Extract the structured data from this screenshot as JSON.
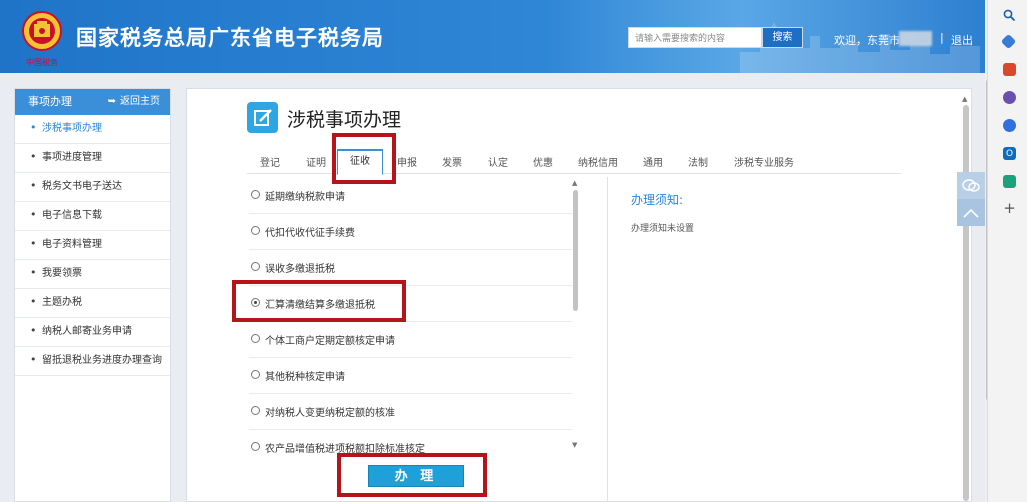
{
  "header": {
    "site_title": "国家税务总局广东省电子税务局",
    "emblem_caption": "中国税务",
    "search": {
      "placeholder": "请输入需要搜索的内容",
      "button_label": "搜索"
    },
    "welcome_text": "欢迎，东莞市",
    "separator": "|",
    "logout_label": "退出"
  },
  "sidebar": {
    "title": "事项办理",
    "back_home_label": "返回主页",
    "items": [
      {
        "label": "涉税事项办理",
        "active": true
      },
      {
        "label": "事项进度管理"
      },
      {
        "label": "税务文书电子送达"
      },
      {
        "label": "电子信息下载"
      },
      {
        "label": "电子资料管理"
      },
      {
        "label": "我要领票"
      },
      {
        "label": "主题办税"
      },
      {
        "label": "纳税人邮寄业务申请"
      },
      {
        "label": "留抵退税业务进度办理查询"
      }
    ]
  },
  "main": {
    "page_title": "涉税事项办理",
    "tabs": [
      {
        "label": "登记"
      },
      {
        "label": "证明"
      },
      {
        "label": "征收",
        "active": true
      },
      {
        "label": "申报"
      },
      {
        "label": "发票"
      },
      {
        "label": "认定"
      },
      {
        "label": "优惠"
      },
      {
        "label": "纳税信用"
      },
      {
        "label": "通用"
      },
      {
        "label": "法制"
      },
      {
        "label": "涉税专业服务"
      }
    ],
    "items": [
      {
        "label": "延期缴纳税款申请",
        "selected": false
      },
      {
        "label": "代扣代收代征手续费",
        "selected": false
      },
      {
        "label": "误收多缴退抵税",
        "selected": false
      },
      {
        "label": "汇算清缴结算多缴退抵税",
        "selected": true
      },
      {
        "label": "个体工商户定期定额核定申请",
        "selected": false
      },
      {
        "label": "其他税种核定申请",
        "selected": false
      },
      {
        "label": "对纳税人变更纳税定额的核准",
        "selected": false
      },
      {
        "label": "农产品增值税进项税额扣除标准核定",
        "selected": false
      }
    ],
    "notice": {
      "title": "办理须知:",
      "body": "办理须知未设置"
    },
    "submit_label": "办 理"
  },
  "colors": {
    "header_blue": "#2f86d6",
    "sidebar_head": "#3b8fd9",
    "accent": "#2b86d8",
    "submit": "#1fa0d8",
    "highlight_red": "#b5141b"
  },
  "icons": {
    "emblem": "tax-emblem-icon",
    "title": "edit-document-icon",
    "back": "back-arrow-icon",
    "wechat": "wechat-icon",
    "to_top": "chevron-up-icon"
  }
}
